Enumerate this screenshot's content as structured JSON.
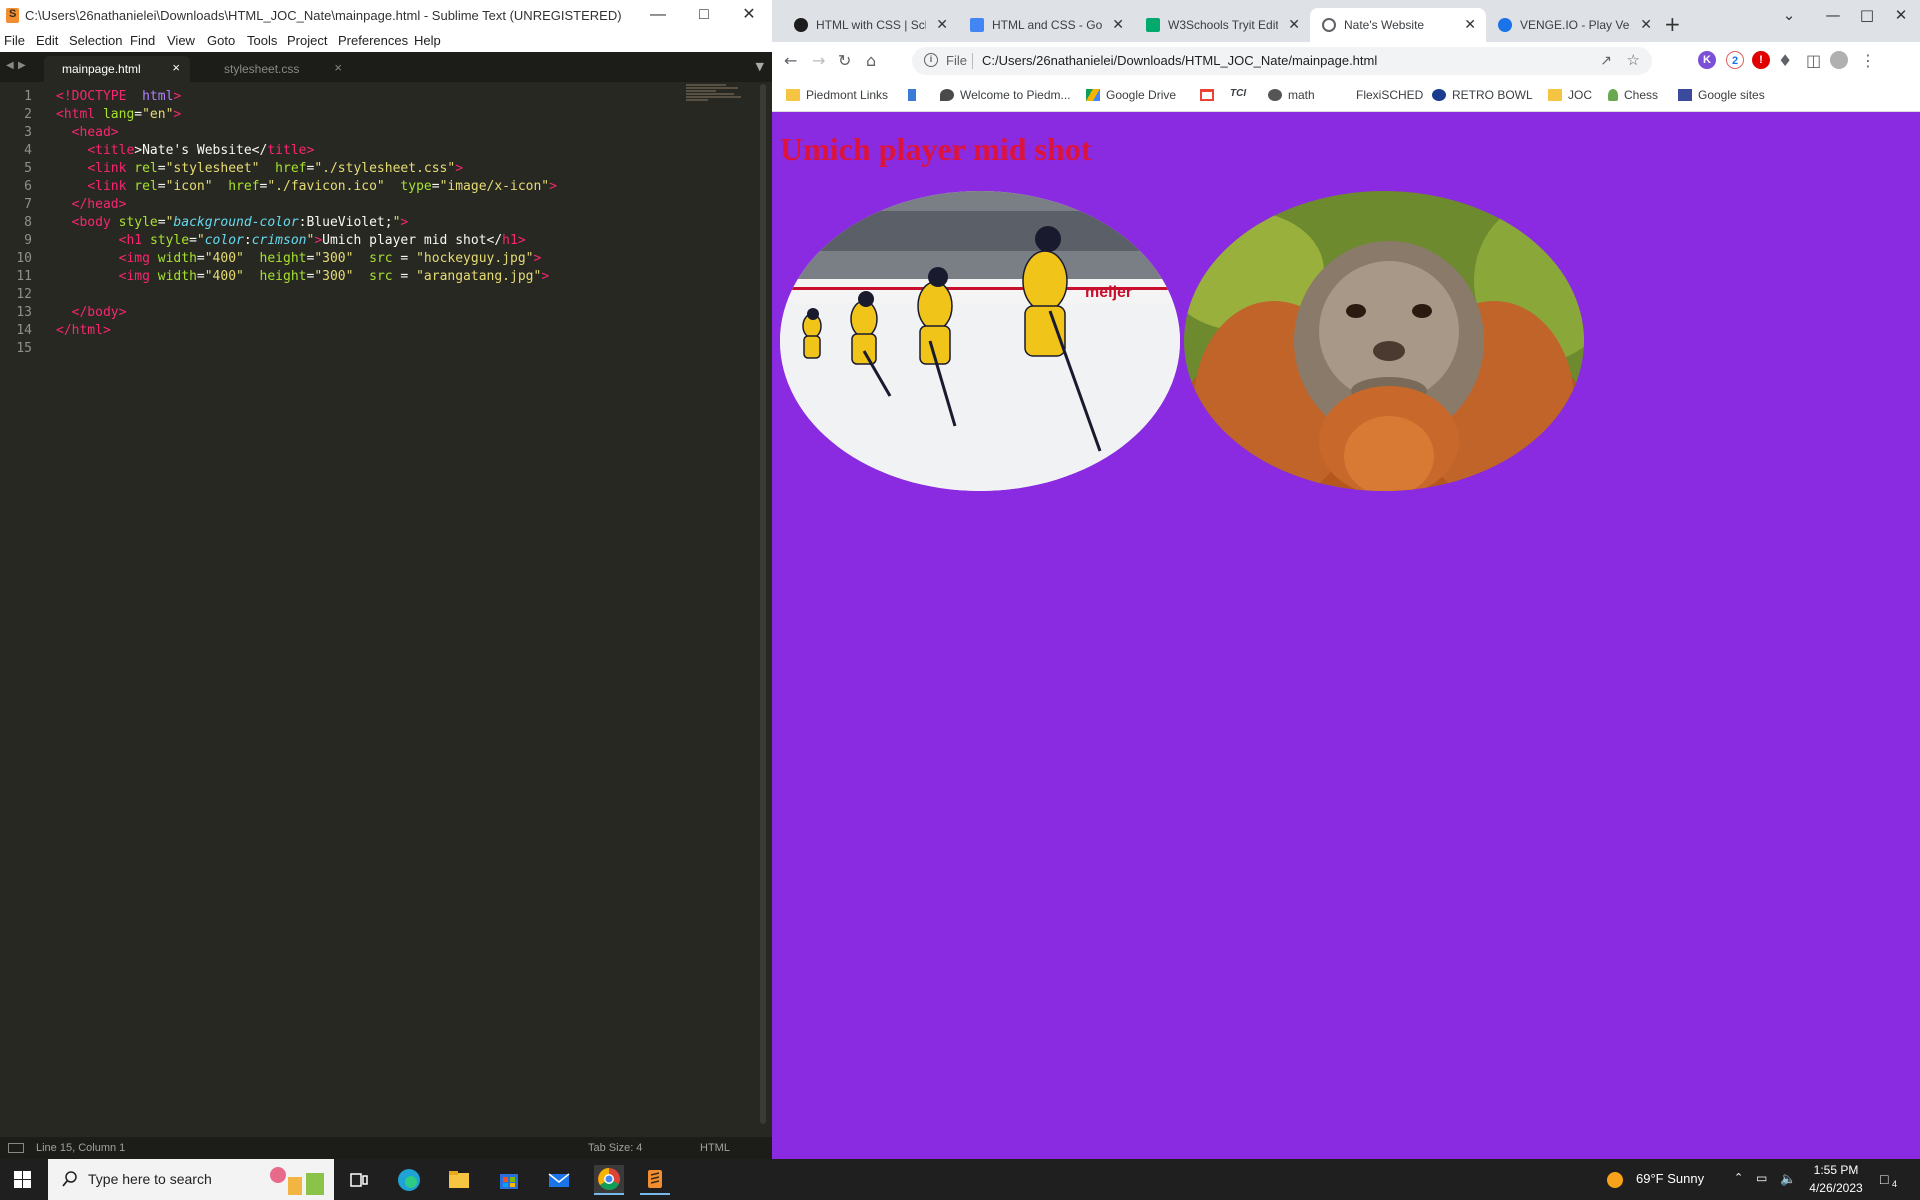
{
  "sublime": {
    "title": "C:\\Users\\26nathanielei\\Downloads\\HTML_JOC_Nate\\mainpage.html - Sublime Text (UNREGISTERED)",
    "menu": [
      "File",
      "Edit",
      "Selection",
      "Find",
      "View",
      "Goto",
      "Tools",
      "Project",
      "Preferences",
      "Help"
    ],
    "tabs": [
      {
        "label": "mainpage.html",
        "active": true
      },
      {
        "label": "stylesheet.css",
        "active": false
      }
    ],
    "line_numbers": [
      "1",
      "2",
      "3",
      "4",
      "5",
      "6",
      "7",
      "8",
      "9",
      "10",
      "11",
      "12",
      "13",
      "14",
      "15"
    ],
    "status": {
      "position": "Line 15, Column 1",
      "tab_size": "Tab Size: 4",
      "syntax": "HTML"
    }
  },
  "chrome": {
    "tabs": [
      {
        "label": "HTML with CSS | Sch",
        "favicon_color": "#1d1d1d"
      },
      {
        "label": "HTML and CSS - Goo",
        "favicon_color": "#4285f4"
      },
      {
        "label": "W3Schools Tryit Edit",
        "favicon_color": "#04aa6d"
      },
      {
        "label": "Nate's Website",
        "favicon_color": "#5f6368"
      },
      {
        "label": "VENGE.IO - Play Ven",
        "favicon_color": "#1a73e8"
      }
    ],
    "address": {
      "scheme": "File",
      "url": "C:/Users/26nathanielei/Downloads/HTML_JOC_Nate/mainpage.html"
    },
    "extensions": [
      {
        "icon": "k-extension-icon",
        "text": "K",
        "color": "#7b4fd6"
      },
      {
        "icon": "badge-extension-icon",
        "text": "2",
        "color": "#1a73e8"
      },
      {
        "icon": "adblock-extension-icon",
        "text": "!",
        "color": "#e00000"
      }
    ],
    "bookmarks": [
      "Piedmont Links",
      "",
      "Welcome to Piedm...",
      "Google Drive",
      "",
      "TCI",
      "math",
      "FlexiSCHED",
      "RETRO BOWL",
      "JOC",
      "Chess",
      "Google sites"
    ],
    "page": {
      "heading": "Umich player mid shot",
      "heading_color": "#dc143c",
      "background": "#8a2be2",
      "images": [
        "hockey-players-image",
        "orangutan-image"
      ]
    }
  },
  "taskbar": {
    "search_placeholder": "Type here to search",
    "weather": "69°F  Sunny",
    "time": "1:55 PM",
    "date": "4/26/2023",
    "notification_count": "4"
  }
}
